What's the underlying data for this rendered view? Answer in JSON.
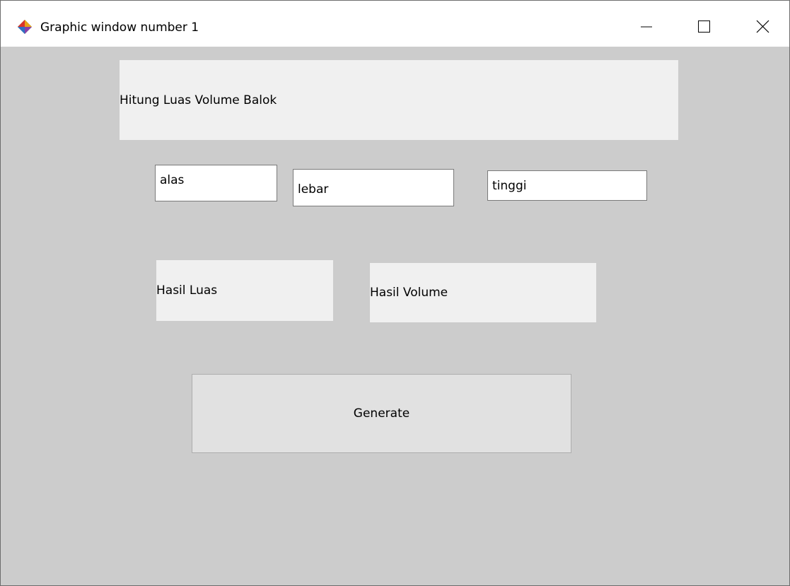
{
  "window": {
    "title": "Graphic window number 1",
    "app_icon": "scilab-diamond-icon",
    "controls": {
      "minimize_icon": "minimize-icon",
      "maximize_icon": "maximize-icon",
      "close_icon": "close-icon"
    }
  },
  "form": {
    "heading": "Hitung Luas Volume Balok",
    "inputs": {
      "alas": "alas",
      "lebar": "lebar",
      "tinggi": "tinggi"
    },
    "outputs": {
      "luas": "Hasil Luas",
      "volume": "Hasil Volume"
    },
    "generate_label": "Generate"
  },
  "colors": {
    "client_background": "#cccccc",
    "panel_background": "#f0f0f0",
    "button_background": "#e1e1e1",
    "field_border": "#7a7a7a"
  }
}
